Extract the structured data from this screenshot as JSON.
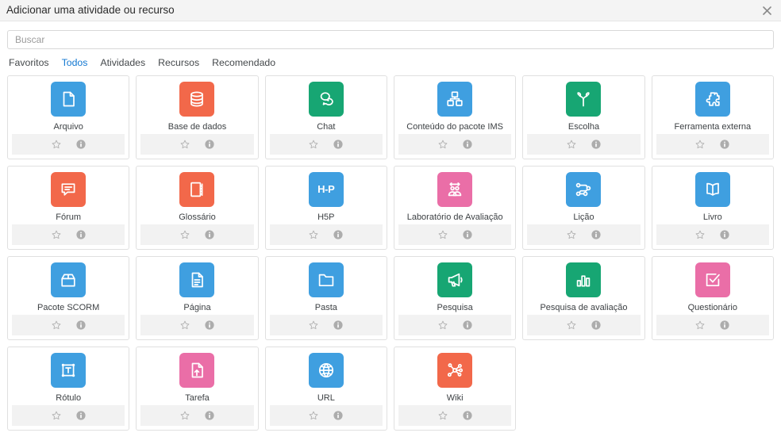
{
  "header": {
    "title": "Adicionar uma atividade ou recurso",
    "close_label": "×"
  },
  "search": {
    "placeholder": "Buscar",
    "value": ""
  },
  "tabs": [
    {
      "label": "Favoritos",
      "active": false
    },
    {
      "label": "Todos",
      "active": true
    },
    {
      "label": "Atividades",
      "active": false
    },
    {
      "label": "Recursos",
      "active": false
    },
    {
      "label": "Recomendado",
      "active": false
    }
  ],
  "colors": {
    "blue": "#3f9fe0",
    "green": "#17a673",
    "red": "#f2684a",
    "pink": "#ea6ea7",
    "header_bg": "#f4f4f4",
    "footer_bg": "#f2f2f2",
    "active_tab": "#1177d1"
  },
  "card_actions": {
    "favorite_label": "Favorito",
    "info_label": "Informação"
  },
  "items": [
    {
      "label": "Arquivo",
      "icon": "file-icon",
      "color": "#3f9fe0"
    },
    {
      "label": "Base de dados",
      "icon": "database-icon",
      "color": "#f2684a"
    },
    {
      "label": "Chat",
      "icon": "chat-bubbles-icon",
      "color": "#17a673"
    },
    {
      "label": "Conteúdo do pacote IMS",
      "icon": "ims-package-icon",
      "color": "#3f9fe0"
    },
    {
      "label": "Escolha",
      "icon": "choice-fork-icon",
      "color": "#17a673"
    },
    {
      "label": "Ferramenta externa",
      "icon": "puzzle-piece-icon",
      "color": "#3f9fe0"
    },
    {
      "label": "Fórum",
      "icon": "forum-icon",
      "color": "#f2684a"
    },
    {
      "label": "Glossário",
      "icon": "glossary-book-icon",
      "color": "#f2684a"
    },
    {
      "label": "H5P",
      "icon": "h5p-wordmark-icon",
      "color": "#3f9fe0",
      "text": "H-P"
    },
    {
      "label": "Laboratório de Avaliação",
      "icon": "workshop-icon",
      "color": "#ea6ea7"
    },
    {
      "label": "Lição",
      "icon": "lesson-path-icon",
      "color": "#3f9fe0"
    },
    {
      "label": "Livro",
      "icon": "open-book-icon",
      "color": "#3f9fe0"
    },
    {
      "label": "Pacote SCORM",
      "icon": "scorm-box-icon",
      "color": "#3f9fe0"
    },
    {
      "label": "Página",
      "icon": "page-document-icon",
      "color": "#3f9fe0"
    },
    {
      "label": "Pasta",
      "icon": "folder-icon",
      "color": "#3f9fe0"
    },
    {
      "label": "Pesquisa",
      "icon": "megaphone-icon",
      "color": "#17a673"
    },
    {
      "label": "Pesquisa de avaliação",
      "icon": "bar-chart-icon",
      "color": "#17a673"
    },
    {
      "label": "Questionário",
      "icon": "checkbox-icon",
      "color": "#ea6ea7"
    },
    {
      "label": "Rótulo",
      "icon": "label-text-icon",
      "color": "#3f9fe0"
    },
    {
      "label": "Tarefa",
      "icon": "assignment-upload-icon",
      "color": "#ea6ea7"
    },
    {
      "label": "URL",
      "icon": "globe-icon",
      "color": "#3f9fe0"
    },
    {
      "label": "Wiki",
      "icon": "wiki-network-icon",
      "color": "#f2684a"
    }
  ]
}
